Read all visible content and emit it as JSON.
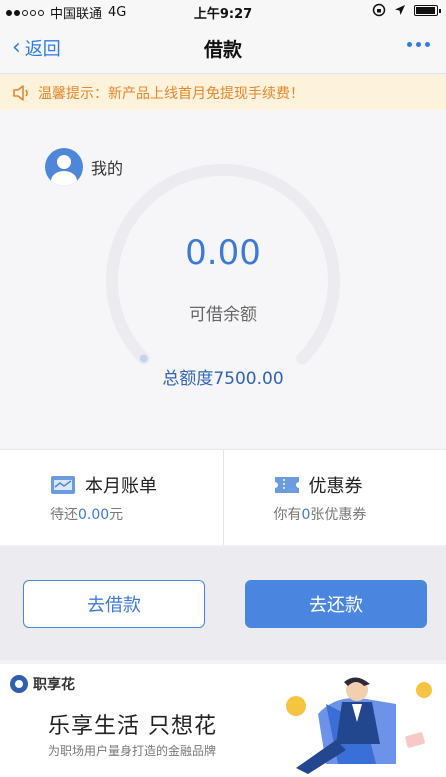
{
  "status_bar": {
    "carrier": "中国联通",
    "network": "4G",
    "time": "上午9:27"
  },
  "nav": {
    "back_label": "返回",
    "title": "借款"
  },
  "notice": {
    "text": "温馨提示：新产品上线首月免提现手续费！"
  },
  "hero": {
    "mine_label": "我的",
    "available_amount": "0.00",
    "available_label": "可借余额",
    "total_quota": "总额度7500.00"
  },
  "cards": {
    "bill": {
      "title": "本月账单",
      "sub_prefix": "待还",
      "sub_value": "0.00",
      "sub_suffix": "元"
    },
    "coupon": {
      "title": "优惠券",
      "sub_prefix": "你有",
      "sub_value": "0",
      "sub_suffix": "张优惠券"
    }
  },
  "actions": {
    "borrow": "去借款",
    "repay": "去还款"
  },
  "banner": {
    "brand": "职享花",
    "slogan": "乐享生活  只想花",
    "sub": "为职场用户量身打造的金融品牌"
  },
  "colors": {
    "accent": "#4a86e0",
    "notice_bg": "#fdf3dc",
    "notice_text": "#e8862a"
  },
  "icons": [
    "signal-dots",
    "lock-rotation-icon",
    "location-icon",
    "battery-icon",
    "back-chevron-icon",
    "more-dots-icon",
    "speaker-icon",
    "avatar-icon",
    "bill-icon",
    "coupon-icon",
    "brand-logo-icon"
  ]
}
